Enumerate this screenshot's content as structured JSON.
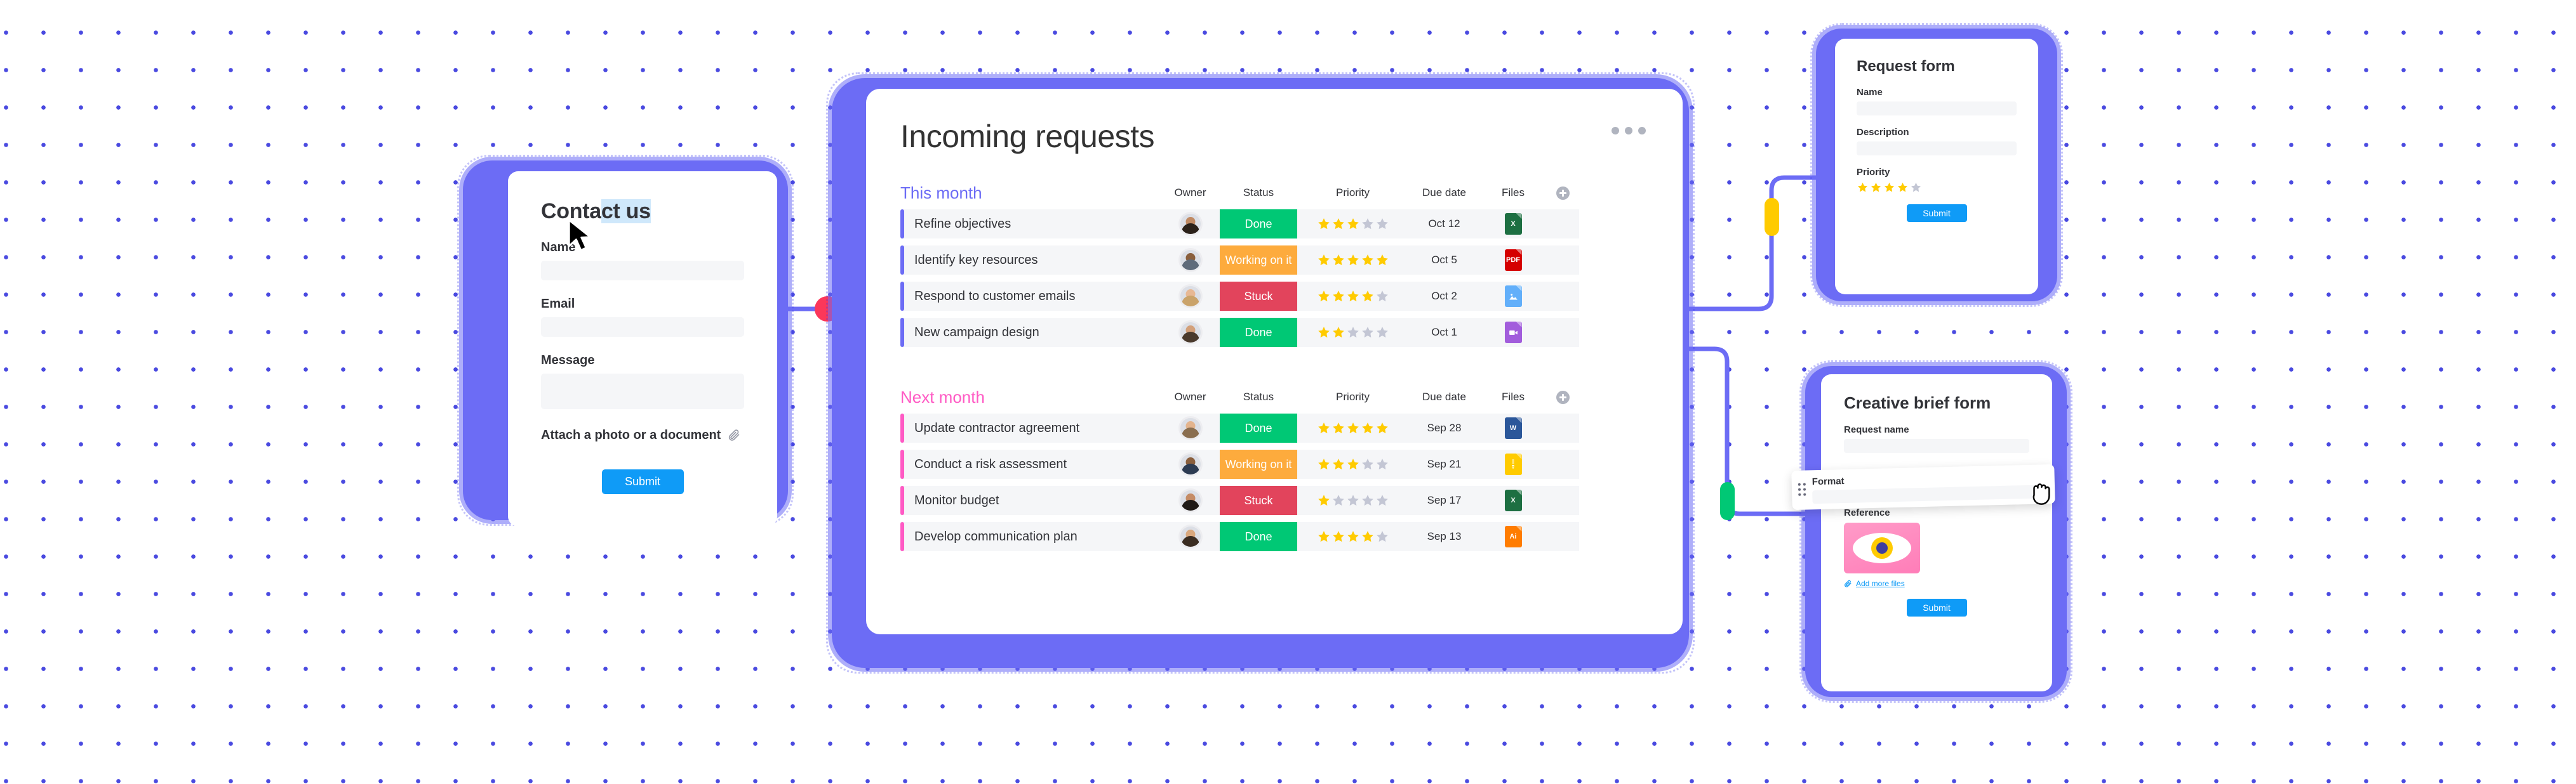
{
  "theme": {
    "purple": "#6C6CF5",
    "pink": "#FF5AC4",
    "blue_button": "#0F9BF7",
    "green": "#00C875",
    "orange": "#FDAB3D",
    "red": "#E2445C",
    "star_on": "#FFCB00",
    "star_off": "#C3C6D4",
    "background": "#FFFFFF",
    "dot_color": "#4A4AE0"
  },
  "contact_card": {
    "title": "Contact us",
    "title_selected_part": "ct us",
    "title_plain_part": "Conta",
    "fields": [
      {
        "label": "Name",
        "value": "",
        "placeholder": ""
      },
      {
        "label": "Email",
        "value": "",
        "placeholder": ""
      },
      {
        "label": "Message",
        "value": "",
        "placeholder": ""
      }
    ],
    "attach_label": "Attach a photo or a document",
    "attach_icon": "paperclip-icon",
    "submit_label": "Submit",
    "cursor": "arrow-cursor"
  },
  "board": {
    "title": "Incoming requests",
    "menu_icon": "kebab-menu-icon",
    "columns": [
      "Owner",
      "Status",
      "Priority",
      "Due date",
      "Files"
    ],
    "add_column_icon": "add-column-icon",
    "groups": [
      {
        "name": "This month",
        "color": "#6C6CF5",
        "rows": [
          {
            "name": "Refine objectives",
            "owner": "owner-avatar-1",
            "avatar_hair": "#2b2119",
            "avatar_skin": "#c08a63",
            "status": "Done",
            "status_color": "#00C875",
            "priority": 3,
            "due_date": "Oct 12",
            "file_type": "excel",
            "file_label": "X",
            "file_color": "#1D6F42"
          },
          {
            "name": "Identify key resources",
            "owner": "owner-avatar-2",
            "avatar_hair": "#5f6b7a",
            "avatar_skin": "#8a5f3d",
            "status": "Working on it",
            "status_color": "#FDAB3D",
            "priority": 5,
            "due_date": "Oct 5",
            "file_type": "pdf",
            "file_label": "PDF",
            "file_color": "#D50000"
          },
          {
            "name": "Respond to customer emails",
            "owner": "owner-avatar-3",
            "avatar_hair": "#caa36a",
            "avatar_skin": "#e7b894",
            "status": "Stuck",
            "status_color": "#E2445C",
            "priority": 4,
            "due_date": "Oct 2",
            "file_type": "image",
            "file_label": "",
            "file_color": "#62AFFA"
          },
          {
            "name": "New campaign design",
            "owner": "owner-avatar-4",
            "avatar_hair": "#4a3a2c",
            "avatar_skin": "#d3a07a",
            "status": "Done",
            "status_color": "#00C875",
            "priority": 2,
            "due_date": "Oct 1",
            "file_type": "video",
            "file_label": "",
            "file_color": "#A25DDC"
          }
        ]
      },
      {
        "name": "Next month",
        "color": "#FF5AC4",
        "rows": [
          {
            "name": "Update contractor agreement",
            "owner": "owner-avatar-5",
            "avatar_hair": "#8a6e4f",
            "avatar_skin": "#e3b48e",
            "status": "Done",
            "status_color": "#00C875",
            "priority": 5,
            "due_date": "Sep 28",
            "file_type": "word",
            "file_label": "W",
            "file_color": "#2B579A"
          },
          {
            "name": "Conduct a risk assessment",
            "owner": "owner-avatar-6",
            "avatar_hair": "#2c3b52",
            "avatar_skin": "#8a5f3d",
            "status": "Working on it",
            "status_color": "#FDAB3D",
            "priority": 3,
            "due_date": "Sep 21",
            "file_type": "zip",
            "file_label": "",
            "file_color": "#FFCB00"
          },
          {
            "name": "Monitor budget",
            "owner": "owner-avatar-7",
            "avatar_hair": "#1f1a17",
            "avatar_skin": "#c58c66",
            "status": "Stuck",
            "status_color": "#E2445C",
            "priority": 1,
            "due_date": "Sep 17",
            "file_type": "excel",
            "file_label": "X",
            "file_color": "#1D6F42"
          },
          {
            "name": "Develop communication plan",
            "owner": "owner-avatar-8",
            "avatar_hair": "#3b2d22",
            "avatar_skin": "#d9a87e",
            "status": "Done",
            "status_color": "#00C875",
            "priority": 4,
            "due_date": "Sep 13",
            "file_type": "illustrator",
            "file_label": "Ai",
            "file_color": "#FF7C00"
          }
        ]
      }
    ]
  },
  "request_form": {
    "title": "Request form",
    "fields": [
      {
        "label": "Name",
        "value": ""
      },
      {
        "label": "Description",
        "value": ""
      }
    ],
    "priority_label": "Priority",
    "priority_value": 4,
    "priority_max": 5,
    "submit_label": "Submit"
  },
  "creative_brief_form": {
    "title": "Creative brief form",
    "request_name_label": "Request name",
    "request_name_value": "",
    "format_label": "Format",
    "format_value": "",
    "format_drag_handle_icon": "drag-handle-icon",
    "reference_label": "Reference",
    "reference_thumb_icon": "eye-illustration",
    "add_more_files_label": "Add more files",
    "add_more_files_icon": "paperclip-icon",
    "submit_label": "Submit",
    "cursor": "grab-hand-cursor"
  },
  "connectors": [
    {
      "name": "contact-to-board",
      "marker": "red-dot",
      "color": "#E2445C"
    },
    {
      "name": "board-to-request-form",
      "marker": "yellow-pill",
      "color": "#FFCB00"
    },
    {
      "name": "board-to-brief-form",
      "marker": "green-pill",
      "color": "#00C875"
    }
  ]
}
